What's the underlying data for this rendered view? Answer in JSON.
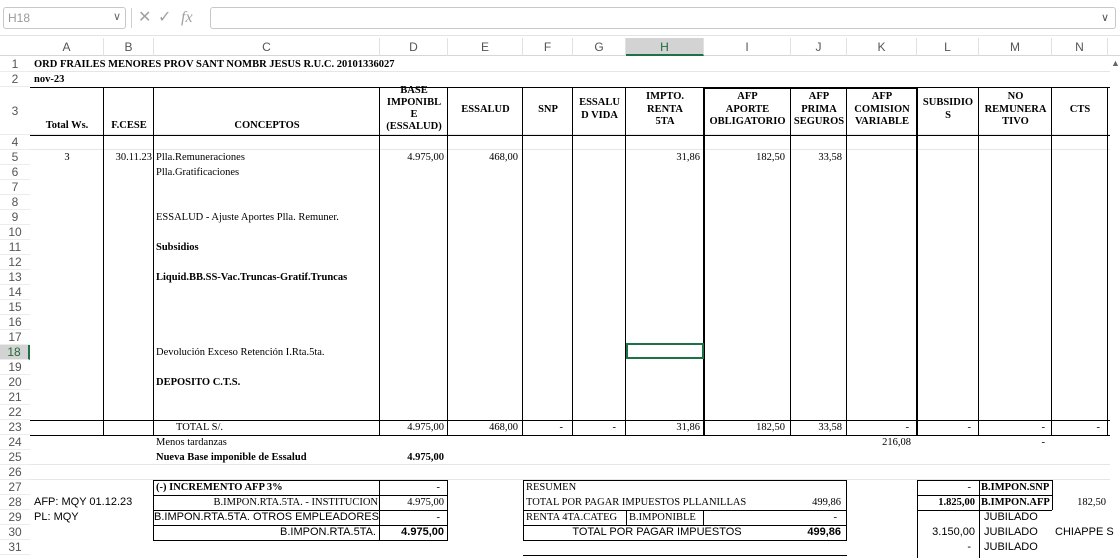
{
  "formula_bar": {
    "name_box": "H18",
    "cancel_icon": "✕",
    "enter_icon": "✓",
    "fx_label": "fx",
    "formula_value": ""
  },
  "columns": [
    "A",
    "B",
    "C",
    "D",
    "E",
    "F",
    "G",
    "H",
    "I",
    "J",
    "K",
    "L",
    "M",
    "N"
  ],
  "rows": [
    "1",
    "2",
    "3",
    "4",
    "5",
    "6",
    "7",
    "8",
    "9",
    "10",
    "11",
    "12",
    "13",
    "14",
    "15",
    "16",
    "17",
    "18",
    "19",
    "20",
    "21",
    "22",
    "23",
    "24",
    "25",
    "26",
    "27",
    "28",
    "29",
    "30",
    "31"
  ],
  "selected": {
    "column": "H",
    "row": "18"
  },
  "sheet": {
    "title": "ORD FRAILES MENORES PROV SANT NOMBR JESUS  R.U.C. 20101336027",
    "period": "nov-23",
    "headers": {
      "total_ws": "Total Ws.",
      "f_cese": "F.CESE",
      "conceptos": "CONCEPTOS",
      "base_imponible": [
        "BASE",
        "IMPONIBL",
        "E",
        "(ESSALUD)"
      ],
      "essalud": "ESSALUD",
      "snp": "SNP",
      "essalud_vida": [
        "ESSALU",
        "D VIDA"
      ],
      "impto_renta": [
        "IMPTO.",
        "RENTA",
        "5TA"
      ],
      "afp_aporte": [
        "AFP",
        "APORTE",
        "OBLIGATORIO"
      ],
      "afp_prima": [
        "AFP",
        "PRIMA",
        "SEGUROS"
      ],
      "afp_comision": [
        "AFP",
        "COMISION",
        "VARIABLE"
      ],
      "subsidios": [
        "SUBSIDIO",
        "S"
      ],
      "no_remunerativo": [
        "NO",
        "REMUNERA",
        "TIVO"
      ],
      "cts": "CTS"
    },
    "row5": {
      "total_ws": "3",
      "f_cese": "30.11.23",
      "concepto": "Plla.Remuneraciones",
      "base": "4.975,00",
      "essalud": "468,00",
      "renta": "31,86",
      "afp_aporte": "182,50",
      "afp_prima": "33,58"
    },
    "concepts": {
      "r6": "Plla.Gratificaciones",
      "r9": "ESSALUD - Ajuste Aportes Plla. Remuner.",
      "r11": "Subsidios",
      "r13": "Liquid.BB.SS-Vac.Truncas-Gratif.Truncas",
      "r18": "Devolución Exceso Retención I.Rta.5ta.",
      "r20": "DEPOSITO C.T.S."
    },
    "totals": {
      "label": "TOTAL   S/.",
      "base": "4.975,00",
      "essalud": "468,00",
      "snp": "-",
      "vida": "-",
      "renta": "31,86",
      "afp_aporte": "182,50",
      "afp_prima": "33,58",
      "afp_comision": "-",
      "subsidios": "-",
      "no_remun": "-",
      "cts": "-"
    },
    "row24": {
      "label": "Menos tardanzas",
      "k": "216,08",
      "m": "-"
    },
    "row25": {
      "label": "Nueva Base imponible de Essalud",
      "value": "4.975,00"
    },
    "row27": {
      "label": "(-) INCREMENTO AFP 3%",
      "value": "-"
    },
    "row28": {
      "a": "AFP: MQY 01.12.23",
      "label": "B.IMPON.RTA.5TA. - INSTITUCION",
      "value": "4.975,00"
    },
    "row29": {
      "a": "PL: MQY",
      "label": "B.IMPON.RTA.5TA. OTROS EMPLEADORES",
      "value": "-"
    },
    "row30": {
      "label": "B.IMPON.RTA.5TA.",
      "value": "4.975,00"
    },
    "resumen": {
      "title": "RESUMEN",
      "line1_label": "TOTAL POR PAGAR IMPUESTOS PLLANILLAS",
      "line1_value": "499,86",
      "line2_label": "RENTA 4TA.CATEG",
      "line2_mid": "B.IMPONIBLE",
      "line2_value": "-",
      "line3_label": "TOTAL POR PAGAR IMPUESTOS",
      "line3_value": "499,86"
    },
    "right_block": {
      "r27": {
        "l": "-",
        "m": "B.IMPON.SNP"
      },
      "r28": {
        "l": "1.825,00",
        "m": "B.IMPON.AFP",
        "n": "182,50"
      },
      "r29": {
        "m": "JUBILADO"
      },
      "r30": {
        "l": "3.150,00",
        "m": "JUBILADO",
        "n": "CHIAPPE S"
      },
      "r31": {
        "l": "-",
        "m": "JUBILADO"
      }
    }
  }
}
